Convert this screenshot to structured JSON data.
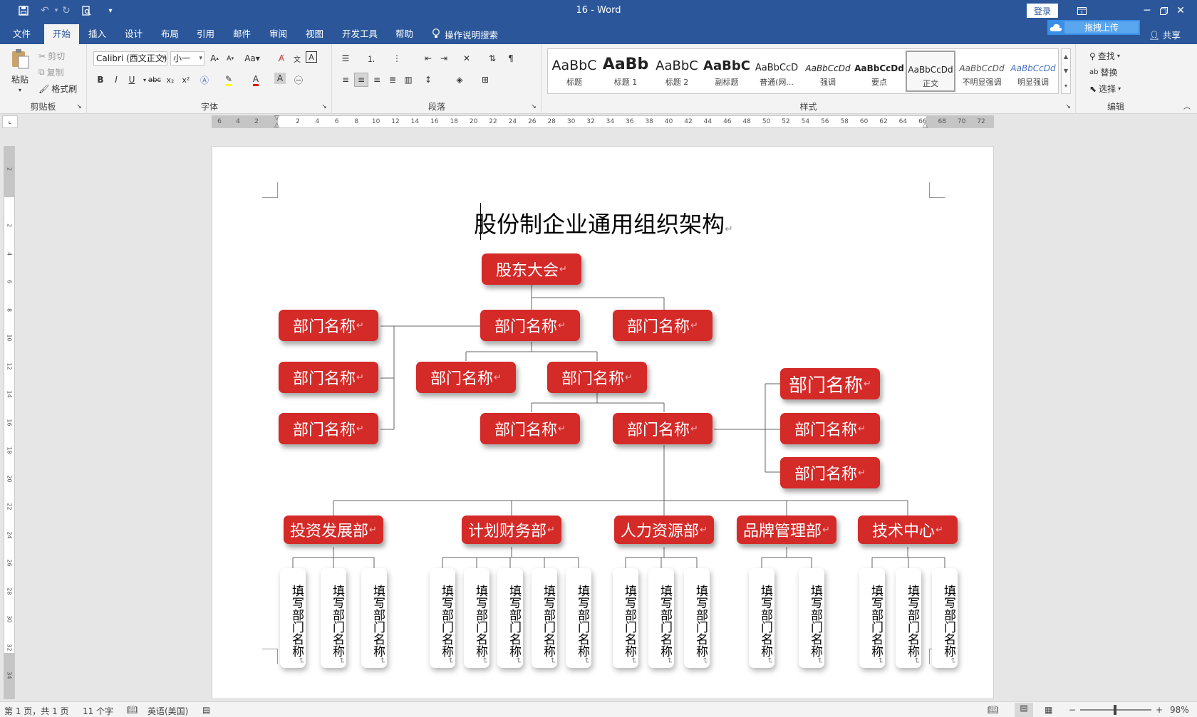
{
  "window": {
    "title": "16  -  Word",
    "login_label": "登录",
    "upload_label": "拖拽上传",
    "share_label": "共享"
  },
  "tabs": [
    {
      "label": "文件",
      "active": false
    },
    {
      "label": "开始",
      "active": true
    },
    {
      "label": "插入",
      "active": false
    },
    {
      "label": "设计",
      "active": false
    },
    {
      "label": "布局",
      "active": false
    },
    {
      "label": "引用",
      "active": false
    },
    {
      "label": "邮件",
      "active": false
    },
    {
      "label": "审阅",
      "active": false
    },
    {
      "label": "视图",
      "active": false
    },
    {
      "label": "开发工具",
      "active": false
    },
    {
      "label": "帮助",
      "active": false
    }
  ],
  "tell_me": "操作说明搜索",
  "ribbon": {
    "clipboard": {
      "label": "剪贴板",
      "paste": "粘贴",
      "cut": "剪切",
      "copy": "复制",
      "format_painter": "格式刷"
    },
    "font": {
      "label": "字体",
      "font_name": "Calibri (西文正文)",
      "font_size": "小一",
      "case_label": "Aa"
    },
    "paragraph": {
      "label": "段落"
    },
    "styles": {
      "label": "样式",
      "items": [
        {
          "preview": "AaBbC",
          "name": "标题"
        },
        {
          "preview": "AaBb",
          "name": "标题 1"
        },
        {
          "preview": "AaBbC",
          "name": "标题 2"
        },
        {
          "preview": "AaBbC",
          "name": "副标题"
        },
        {
          "preview": "AaBbCcD",
          "name": "普通(网..."
        },
        {
          "preview": "AaBbCcDd",
          "name": "强调"
        },
        {
          "preview": "AaBbCcDd",
          "name": "要点"
        },
        {
          "preview": "AaBbCcDd",
          "name": "正文"
        },
        {
          "preview": "AaBbCcDd",
          "name": "不明显强调"
        },
        {
          "preview": "AaBbCcDd",
          "name": "明显强调"
        }
      ]
    },
    "editing": {
      "label": "编辑",
      "find": "查找",
      "replace": "替换",
      "select": "选择"
    }
  },
  "ruler_ticks": [
    "6",
    "4",
    "2",
    "2",
    "4",
    "6",
    "8",
    "10",
    "12",
    "14",
    "16",
    "18",
    "20",
    "22",
    "24",
    "26",
    "28",
    "30",
    "32",
    "34",
    "36",
    "38",
    "40",
    "42",
    "44",
    "46",
    "48",
    "50",
    "52",
    "54",
    "56",
    "58",
    "60",
    "62",
    "64",
    "66",
    "68",
    "70",
    "72"
  ],
  "vruler_ticks": [
    "2",
    "",
    "2",
    "4",
    "6",
    "8",
    "10",
    "12",
    "14",
    "16",
    "18",
    "20",
    "22",
    "24",
    "26",
    "28",
    "30",
    "32",
    "34"
  ],
  "document": {
    "heading": "股份制企业通用组织架构",
    "top_box": "股东大会",
    "dept_label": "部门名称",
    "departments": [
      "投资发展部",
      "计划财务部",
      "人力资源部",
      "品牌管理部",
      "技术中心"
    ],
    "sub_label": "填写部门名称"
  },
  "status": {
    "page": "第 1 页，共 1 页",
    "words": "11 个字",
    "language": "英语(美国)",
    "zoom": "98%"
  },
  "colors": {
    "title_bar": "#2b579a",
    "box_red": "#d42a28"
  }
}
